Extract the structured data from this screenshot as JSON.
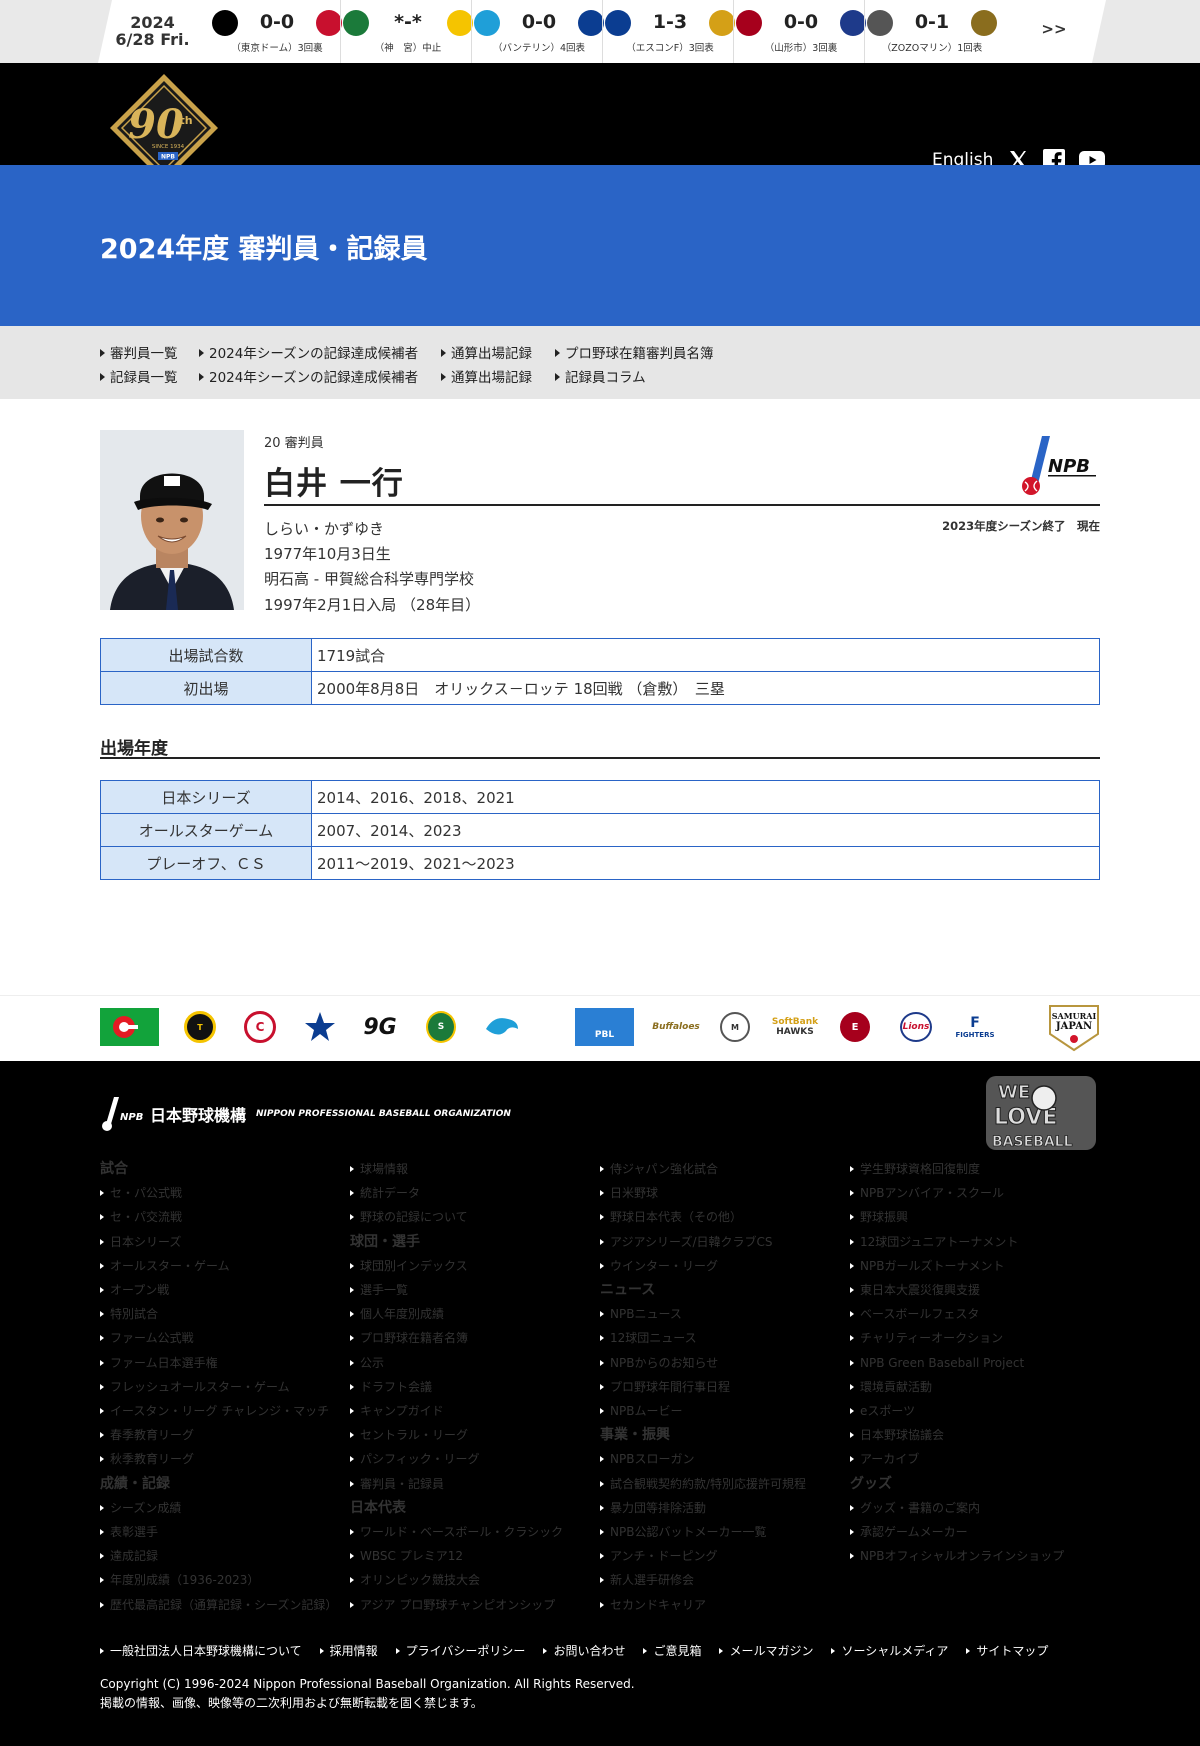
{
  "scorebar": {
    "date": "2024",
    "day": "6/28 Fri.",
    "games": [
      {
        "score": "0-0",
        "status": "（東京ドーム）3回裏",
        "left_team": "giants-logo",
        "right_team": "carp-logo",
        "left_color": "#000000",
        "right_color": "#c8102e"
      },
      {
        "score": "*-*",
        "status": "（神　宮）中止",
        "left_team": "swallows-logo",
        "right_team": "tigers-logo",
        "left_color": "#1b7a3a",
        "right_color": "#f5c400"
      },
      {
        "score": "0-0",
        "status": "（バンテリン）4回表",
        "left_team": "dragons-logo",
        "right_team": "baystars-logo",
        "left_color": "#1f9fd8",
        "right_color": "#0b3d91"
      },
      {
        "score": "1-3",
        "status": "（エスコンF）3回表",
        "left_team": "fighters-logo",
        "right_team": "hawks-logo",
        "left_color": "#0b3d91",
        "right_color": "#d4a017"
      },
      {
        "score": "0-0",
        "status": "（山形市）3回裏",
        "left_team": "eagles-logo",
        "right_team": "lions-logo",
        "left_color": "#a6001c",
        "right_color": "#1e3a8a"
      },
      {
        "score": "0-1",
        "status": "（ZOZOマリン）1回表",
        "left_team": "marines-logo",
        "right_team": "buffaloes-logo",
        "left_color": "#555555",
        "right_color": "#8a6d1e"
      }
    ],
    "more": ">>"
  },
  "header": {
    "logo_text": "90th",
    "logo_sub": "SINCE 1934",
    "english": "English",
    "nav": [
      "試合",
      "成績・記録",
      "球団・選手",
      "日本代表",
      "ニュース",
      "事業・振興",
      "グッズ"
    ]
  },
  "page_title": "2024年度 審判員・記録員",
  "subnav": {
    "row1": [
      "審判員一覧",
      "2024年シーズンの記録達成候補者",
      "通算出場記録",
      "プロ野球在籍審判員名簿"
    ],
    "row2": [
      "記録員一覧",
      "2024年シーズンの記録達成候補者",
      "通算出場記録",
      "記録員コラム"
    ]
  },
  "profile": {
    "number_role": "20 審判員",
    "name": "白井 一行",
    "kana": "しらい・かずゆき",
    "birth": "1977年10月3日生",
    "school": "明石高 - 甲賀総合科学専門学校",
    "entry": "1997年2月1日入局 （28年目）",
    "season_note": "2023年度シーズン終了　現在",
    "npb_mark": "NPB"
  },
  "stats": [
    {
      "label": "出場試合数",
      "value": "1719試合"
    },
    {
      "label": "初出場",
      "value": "2000年8月8日　オリックス－ロッテ 18回戦 （倉敷）　三塁"
    }
  ],
  "appearances": {
    "heading": "出場年度",
    "rows": [
      {
        "label": "日本シリーズ",
        "value": "2014、2016、2018、2021"
      },
      {
        "label": "オールスターゲーム",
        "value": "2007、2014、2023"
      },
      {
        "label": "プレーオフ、ＣＳ",
        "value": "2011～2019、2021～2023"
      }
    ]
  },
  "team_strip": {
    "teams": [
      "carp-logo",
      "tigers-logo",
      "carp-logo",
      "baystars-logo",
      "giants-logo",
      "swallows-logo",
      "dragons-logo",
      "pbl-logo",
      "buffaloes-logo",
      "marines-logo",
      "hawks-logo",
      "eagles-logo",
      "lions-logo",
      "fighters-logo",
      "samurai-japan-logo"
    ],
    "pbl": "PBL",
    "samurai": "SAMURAI JAPAN"
  },
  "footer": {
    "org_name": "日本野球機構",
    "org_en": "NIPPON PROFESSIONAL BASEBALL ORGANIZATION",
    "we_love": "WE LOVE BASEBALL",
    "col1": [
      {
        "t": "h",
        "v": "試合"
      },
      {
        "t": "i",
        "v": "セ・パ公式戦"
      },
      {
        "t": "i",
        "v": "セ・パ交流戦"
      },
      {
        "t": "i",
        "v": "日本シリーズ"
      },
      {
        "t": "i",
        "v": "オールスター・ゲーム"
      },
      {
        "t": "i",
        "v": "オープン戦"
      },
      {
        "t": "i",
        "v": "特別試合"
      },
      {
        "t": "i",
        "v": "ファーム公式戦"
      },
      {
        "t": "i",
        "v": "ファーム日本選手権"
      },
      {
        "t": "i",
        "v": "フレッシュオールスター・ゲーム"
      },
      {
        "t": "i",
        "v": "イースタン・リーグ チャレンジ・マッチ"
      },
      {
        "t": "i",
        "v": "春季教育リーグ"
      },
      {
        "t": "i",
        "v": "秋季教育リーグ"
      },
      {
        "t": "h",
        "v": "成績・記録"
      },
      {
        "t": "i",
        "v": "シーズン成績"
      },
      {
        "t": "i",
        "v": "表彰選手"
      },
      {
        "t": "i",
        "v": "達成記録"
      },
      {
        "t": "i",
        "v": "年度別成績（1936-2023）"
      },
      {
        "t": "i",
        "v": "歴代最高記録（通算記録・シーズン記録）"
      }
    ],
    "col2": [
      {
        "t": "i",
        "v": "球場情報"
      },
      {
        "t": "i",
        "v": "統計データ"
      },
      {
        "t": "i",
        "v": "野球の記録について"
      },
      {
        "t": "h",
        "v": "球団・選手"
      },
      {
        "t": "i",
        "v": "球団別インデックス"
      },
      {
        "t": "i",
        "v": "選手一覧"
      },
      {
        "t": "i",
        "v": "個人年度別成績"
      },
      {
        "t": "i",
        "v": "プロ野球在籍者名簿"
      },
      {
        "t": "i",
        "v": "公示"
      },
      {
        "t": "i",
        "v": "ドラフト会議"
      },
      {
        "t": "i",
        "v": "キャンプガイド"
      },
      {
        "t": "i",
        "v": "セントラル・リーグ"
      },
      {
        "t": "i",
        "v": "パシフィック・リーグ"
      },
      {
        "t": "i",
        "v": "審判員・記録員"
      },
      {
        "t": "h",
        "v": "日本代表"
      },
      {
        "t": "i",
        "v": "ワールド・ベースボール・クラシック"
      },
      {
        "t": "i",
        "v": "WBSC プレミア12"
      },
      {
        "t": "i",
        "v": "オリンピック競技大会"
      },
      {
        "t": "i",
        "v": "アジア プロ野球チャンピオンシップ"
      }
    ],
    "col3": [
      {
        "t": "i",
        "v": "侍ジャパン強化試合"
      },
      {
        "t": "i",
        "v": "日米野球"
      },
      {
        "t": "i",
        "v": "野球日本代表（その他）"
      },
      {
        "t": "i",
        "v": "アジアシリーズ/日韓クラブCS"
      },
      {
        "t": "i",
        "v": "ウインター・リーグ"
      },
      {
        "t": "h",
        "v": "ニュース"
      },
      {
        "t": "i",
        "v": "NPBニュース"
      },
      {
        "t": "i",
        "v": "12球団ニュース"
      },
      {
        "t": "i",
        "v": "NPBからのお知らせ"
      },
      {
        "t": "i",
        "v": "プロ野球年間行事日程"
      },
      {
        "t": "i",
        "v": "NPBムービー"
      },
      {
        "t": "h",
        "v": "事業・振興"
      },
      {
        "t": "i",
        "v": "NPBスローガン"
      },
      {
        "t": "i",
        "v": "試合観戦契約約款/特別応援許可規程"
      },
      {
        "t": "i",
        "v": "暴力団等排除活動"
      },
      {
        "t": "i",
        "v": "NPB公認バットメーカー一覧"
      },
      {
        "t": "i",
        "v": "アンチ・ドーピング"
      },
      {
        "t": "i",
        "v": "新人選手研修会"
      },
      {
        "t": "i",
        "v": "セカンドキャリア"
      }
    ],
    "col4": [
      {
        "t": "i",
        "v": "学生野球資格回復制度"
      },
      {
        "t": "i",
        "v": "NPBアンバイア・スクール"
      },
      {
        "t": "i",
        "v": "野球振興"
      },
      {
        "t": "i",
        "v": "12球団ジュニアトーナメント"
      },
      {
        "t": "i",
        "v": "NPBガールズトーナメント"
      },
      {
        "t": "i",
        "v": "東日本大震災復興支援"
      },
      {
        "t": "i",
        "v": "ベースボールフェスタ"
      },
      {
        "t": "i",
        "v": "チャリティーオークション"
      },
      {
        "t": "i",
        "v": "NPB Green Baseball Project"
      },
      {
        "t": "i",
        "v": "環境貢献活動"
      },
      {
        "t": "i",
        "v": "eスポーツ"
      },
      {
        "t": "i",
        "v": "日本野球協議会"
      },
      {
        "t": "i",
        "v": "アーカイブ"
      },
      {
        "t": "h",
        "v": "グッズ"
      },
      {
        "t": "i",
        "v": "グッズ・書籍のご案内"
      },
      {
        "t": "i",
        "v": "承認ゲームメーカー"
      },
      {
        "t": "i",
        "v": "NPBオフィシャルオンラインショップ"
      }
    ],
    "links": [
      "一般社団法人日本野球機構について",
      "採用情報",
      "プライバシーポリシー",
      "お問い合わせ",
      "ご意見箱",
      "メールマガジン",
      "ソーシャルメディア",
      "サイトマップ"
    ],
    "copyright": "Copyright (C) 1996-2024 Nippon Professional Baseball Organization. All Rights Reserved.",
    "notice": "掲載の情報、画像、映像等の二次利用および無断転載を固く禁じます。"
  }
}
